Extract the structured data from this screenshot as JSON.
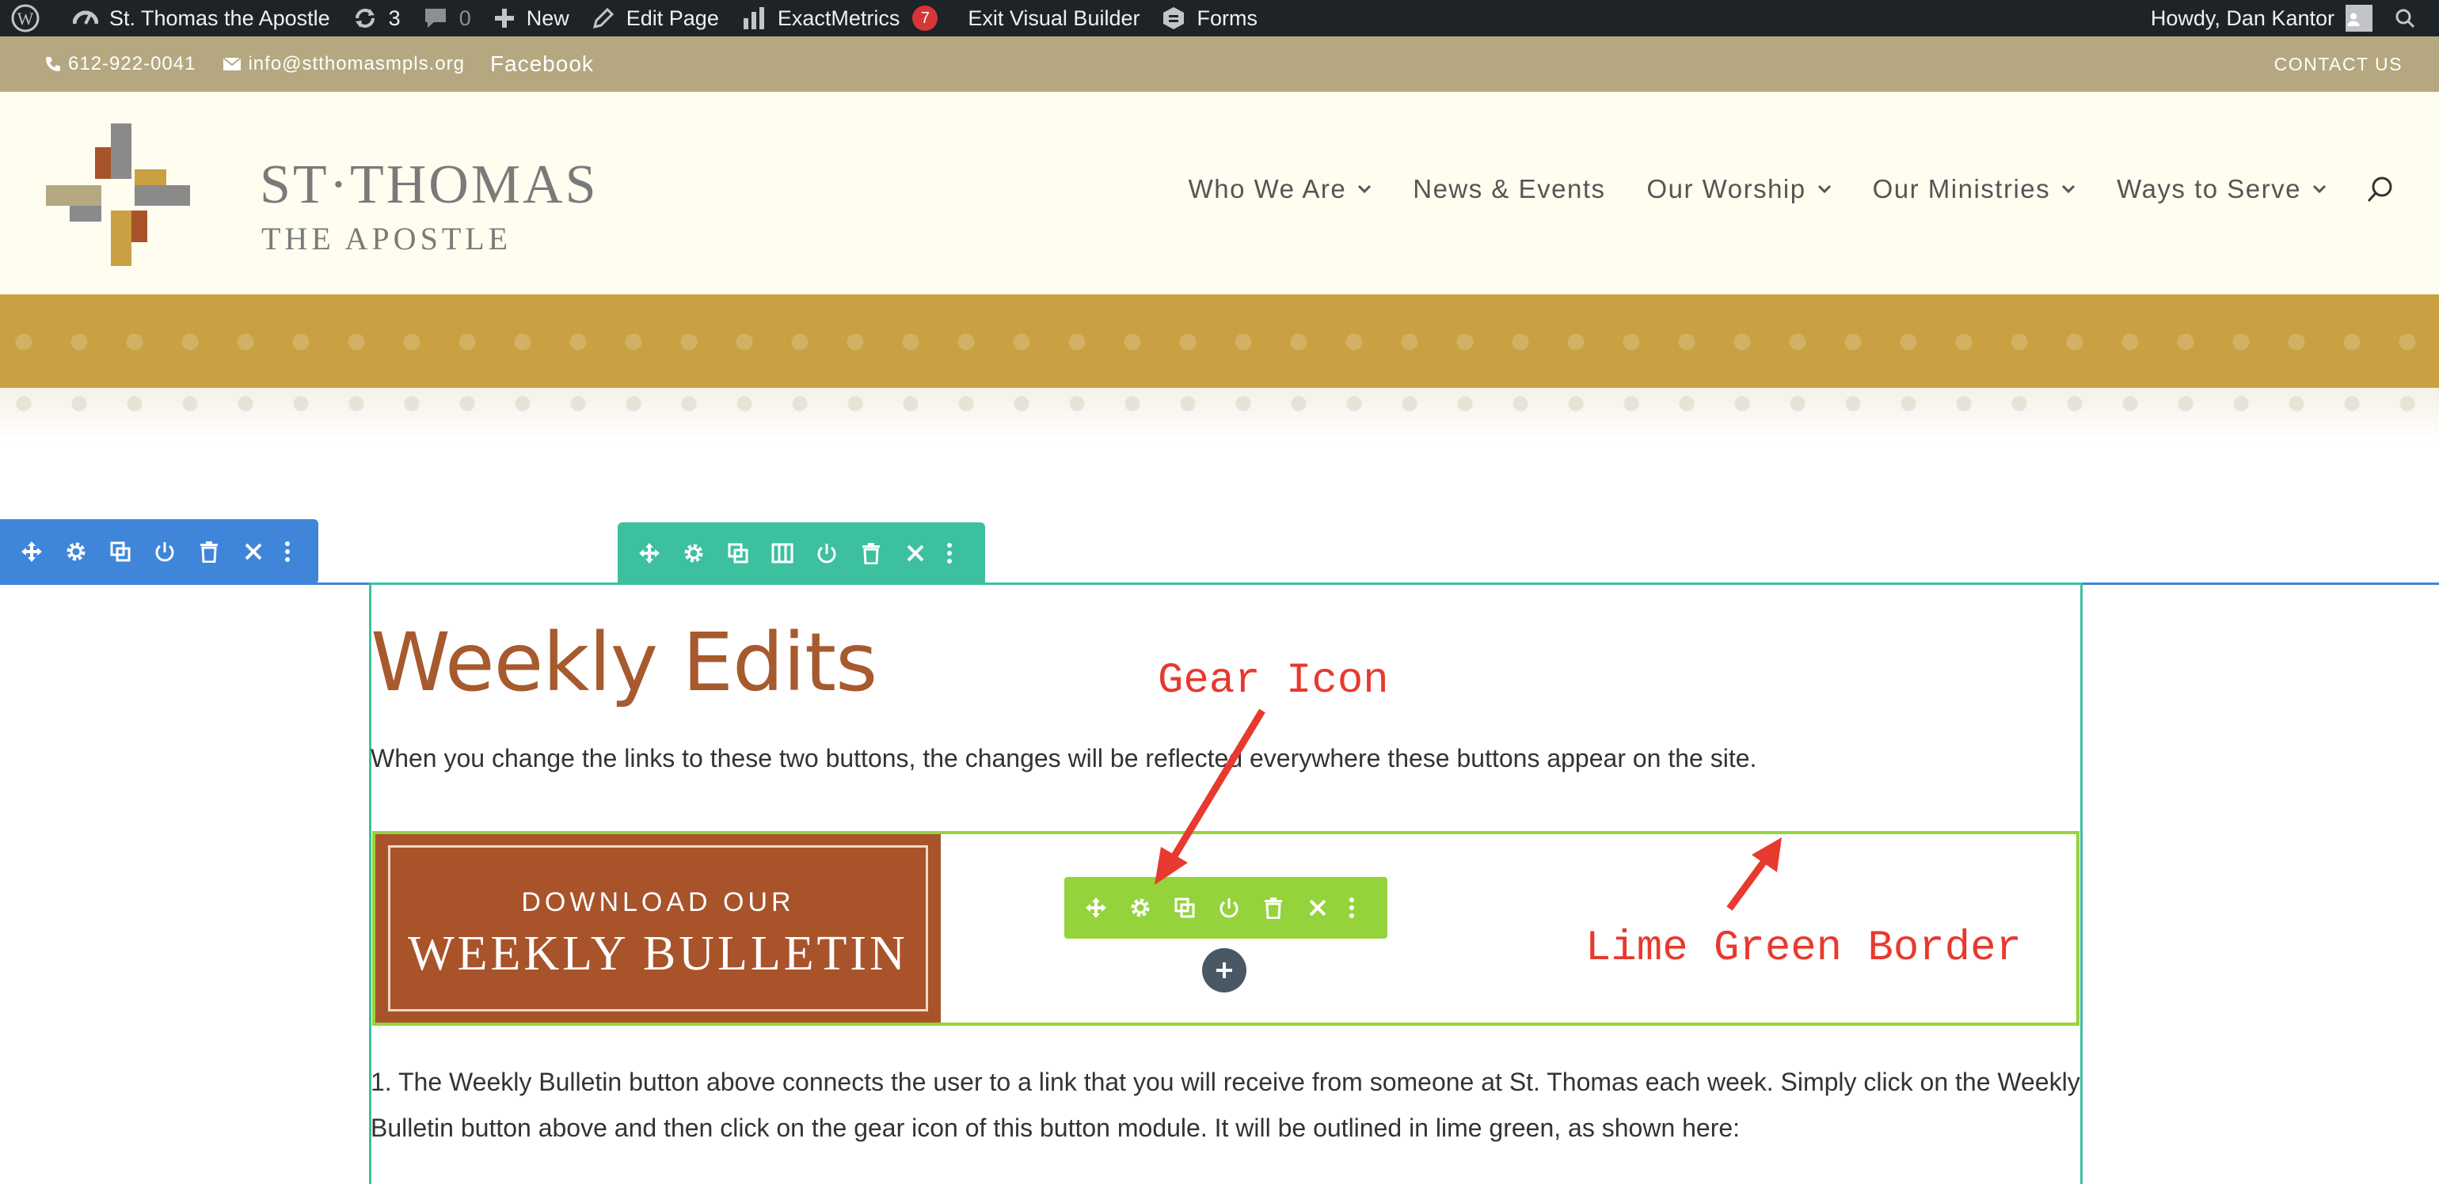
{
  "admin_bar": {
    "site_name": "St. Thomas the Apostle",
    "updates_count": "3",
    "comments_count": "0",
    "new_label": "New",
    "edit_page_label": "Edit Page",
    "exactmetrics_label": "ExactMetrics",
    "exactmetrics_badge": "7",
    "exit_vb_label": "Exit Visual Builder",
    "forms_label": "Forms",
    "howdy": "Howdy, Dan Kantor"
  },
  "top_bar": {
    "phone": "612-922-0041",
    "email": "info@stthomasmpls.org",
    "facebook": "Facebook",
    "contact": "CONTACT US"
  },
  "header": {
    "logo_line1": "ST·THOMAS",
    "logo_line2": "THE APOSTLE",
    "nav": [
      {
        "label": "Who We Are",
        "has_dropdown": true
      },
      {
        "label": "News & Events",
        "has_dropdown": false
      },
      {
        "label": "Our Worship",
        "has_dropdown": true
      },
      {
        "label": "Our Ministries",
        "has_dropdown": true
      },
      {
        "label": "Ways to Serve",
        "has_dropdown": true
      }
    ]
  },
  "content": {
    "title": "Weekly Edits",
    "intro": "When you change the links to these two buttons, the changes will be reflected everywhere these buttons appear on the site.",
    "bulletin_line1": "DOWNLOAD OUR",
    "bulletin_line2": "WEEKLY BULLETIN",
    "step1": "1. The Weekly Bulletin button above connects the user to a link that you will receive from someone at St. Thomas each week. Simply click on the Weekly Bulletin button above and then click on the gear icon of this button module. It will be outlined in lime green, as shown here:"
  },
  "annotations": {
    "gear": "Gear Icon",
    "lime": "Lime Green Border"
  },
  "colors": {
    "admin_bar": "#1d2327",
    "top_bar": "#b5a880",
    "header_bg": "#fffdf0",
    "band": "#c9a042",
    "section_toolbar": "#3f85da",
    "row_toolbar": "#3cc0a0",
    "module_toolbar": "#94d33c",
    "title": "#a65a2e",
    "bulletin": "#a9532b",
    "annotation": "#e8392e"
  }
}
